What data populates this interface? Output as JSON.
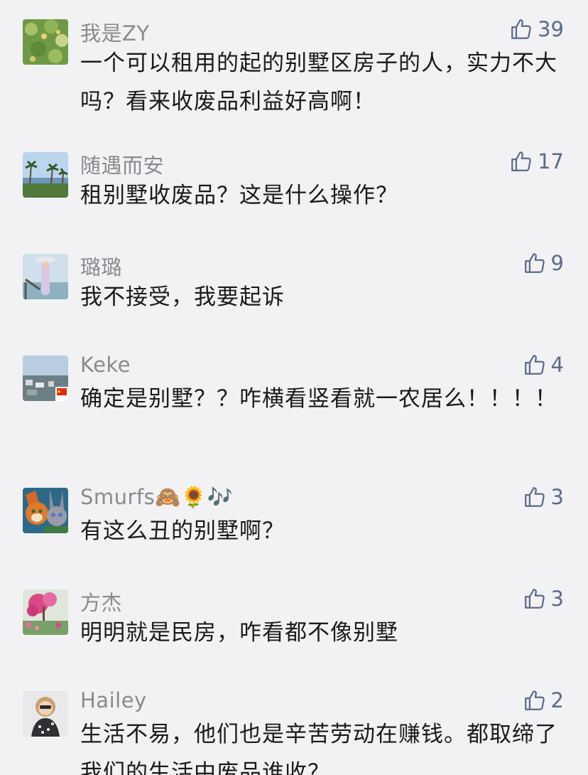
{
  "comments": [
    {
      "user": "我是ZY",
      "likes": "39",
      "text": "一个可以租用的起的别墅区房子的人，实力不大吗？看来收废品利益好高啊！"
    },
    {
      "user": "随遇而安",
      "likes": "17",
      "text": "租别墅收废品？这是什么操作？"
    },
    {
      "user": "璐璐",
      "likes": "9",
      "text": "我不接受，我要起诉"
    },
    {
      "user": "Keke",
      "likes": "4",
      "text": "确定是别墅？？咋横看竖看就一农居么！！！！"
    },
    {
      "user": "Smurfs🙈🌻🎶",
      "likes": "3",
      "text": "有这么丑的别墅啊？"
    },
    {
      "user": "方杰",
      "likes": "3",
      "text": "明明就是民房，咋看都不像别墅"
    },
    {
      "user": "Hailey",
      "likes": "2",
      "text": "生活不易，他们也是辛苦劳动在赚钱。都取缔了我们的生活中废品谁收？"
    }
  ],
  "colors": {
    "background": "#f2f2f4",
    "username": "#8a8a8f",
    "like": "#5b6b8c",
    "text": "#1a1a1a"
  }
}
